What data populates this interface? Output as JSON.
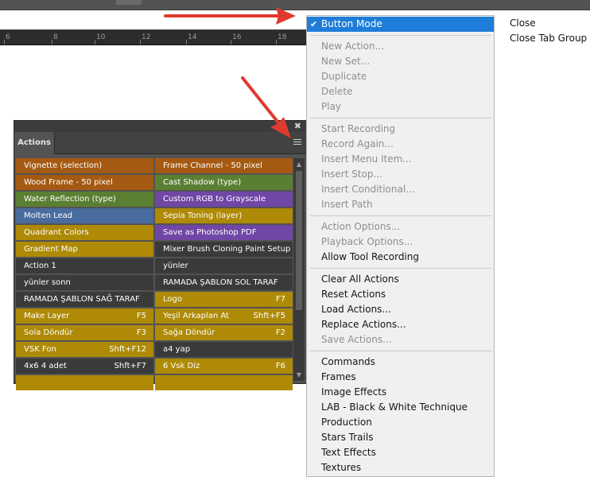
{
  "colors": {
    "orange": "#a45a12",
    "green": "#5a7f32",
    "purple": "#7046a6",
    "blue": "#4a6b9e",
    "yellow": "#ae8a06",
    "gray": "#3a3a3a",
    "menu_highlight": "#1e7dd8",
    "arrow_red": "#e03a2f"
  },
  "ruler": {
    "ticks": [
      "6",
      "8",
      "10",
      "12",
      "14",
      "16",
      "18"
    ]
  },
  "actions_panel": {
    "tab_label": "Actions",
    "close_glyph": "✖",
    "menu_icon": "hamburger-menu-icon",
    "rows": [
      [
        {
          "label": "Vignette (selection)",
          "key": "",
          "color": "orange"
        },
        {
          "label": "Frame Channel - 50 pixel",
          "key": "",
          "color": "orange"
        }
      ],
      [
        {
          "label": "Wood Frame - 50 pixel",
          "key": "",
          "color": "orange"
        },
        {
          "label": "Cast Shadow (type)",
          "key": "",
          "color": "green"
        }
      ],
      [
        {
          "label": "Water Reflection (type)",
          "key": "",
          "color": "green"
        },
        {
          "label": "Custom RGB to Grayscale",
          "key": "",
          "color": "purple"
        }
      ],
      [
        {
          "label": "Molten Lead",
          "key": "",
          "color": "blue"
        },
        {
          "label": "Sepia Toning (layer)",
          "key": "",
          "color": "yellow"
        }
      ],
      [
        {
          "label": "Quadrant Colors",
          "key": "",
          "color": "yellow"
        },
        {
          "label": "Save as Photoshop PDF",
          "key": "",
          "color": "purple"
        }
      ],
      [
        {
          "label": "Gradient Map",
          "key": "",
          "color": "yellow"
        },
        {
          "label": "Mixer Brush Cloning Paint Setup",
          "key": "",
          "color": "gray"
        }
      ],
      [
        {
          "label": "Action 1",
          "key": "",
          "color": "gray"
        },
        {
          "label": "yünler",
          "key": "",
          "color": "gray"
        }
      ],
      [
        {
          "label": "yünler sonn",
          "key": "",
          "color": "gray"
        },
        {
          "label": "RAMADA ŞABLON SOL TARAF",
          "key": "",
          "color": "gray"
        }
      ],
      [
        {
          "label": "RAMADA ŞABLON SAĞ TARAF",
          "key": "",
          "color": "gray"
        },
        {
          "label": "Logo",
          "key": "F7",
          "color": "yellow"
        }
      ],
      [
        {
          "label": "Make Layer",
          "key": "F5",
          "color": "yellow"
        },
        {
          "label": "Yeşil Arkaplan At",
          "key": "Shft+F5",
          "color": "yellow"
        }
      ],
      [
        {
          "label": "Sola Döndür",
          "key": "F3",
          "color": "yellow"
        },
        {
          "label": "Sağa Döndür",
          "key": "F2",
          "color": "yellow"
        }
      ],
      [
        {
          "label": "VSK Fon",
          "key": "Shft+F12",
          "color": "yellow"
        },
        {
          "label": "a4 yap",
          "key": "",
          "color": "gray"
        }
      ],
      [
        {
          "label": "4x6 4 adet",
          "key": "Shft+F7",
          "color": "gray"
        },
        {
          "label": "6 Vsk Diz",
          "key": "F6",
          "color": "yellow"
        }
      ],
      [
        {
          "label": "",
          "key": "",
          "color": "yellow"
        },
        {
          "label": "",
          "key": "",
          "color": "yellow"
        }
      ]
    ]
  },
  "panel_menu": {
    "check_glyph": "✔",
    "items": [
      {
        "label": "Button Mode",
        "state": "selected",
        "checked": true,
        "sep_after": false
      },
      {
        "label": "",
        "state": "sep"
      },
      {
        "label": "New Action...",
        "state": "disabled"
      },
      {
        "label": "New Set...",
        "state": "disabled"
      },
      {
        "label": "Duplicate",
        "state": "disabled"
      },
      {
        "label": "Delete",
        "state": "disabled"
      },
      {
        "label": "Play",
        "state": "disabled"
      },
      {
        "label": "",
        "state": "sep"
      },
      {
        "label": "Start Recording",
        "state": "disabled"
      },
      {
        "label": "Record Again...",
        "state": "disabled"
      },
      {
        "label": "Insert Menu Item...",
        "state": "disabled"
      },
      {
        "label": "Insert Stop...",
        "state": "disabled"
      },
      {
        "label": "Insert Conditional...",
        "state": "disabled"
      },
      {
        "label": "Insert Path",
        "state": "disabled"
      },
      {
        "label": "",
        "state": "sep"
      },
      {
        "label": "Action Options...",
        "state": "disabled"
      },
      {
        "label": "Playback Options...",
        "state": "disabled"
      },
      {
        "label": "Allow Tool Recording",
        "state": "enabled"
      },
      {
        "label": "",
        "state": "sep"
      },
      {
        "label": "Clear All Actions",
        "state": "enabled"
      },
      {
        "label": "Reset Actions",
        "state": "enabled"
      },
      {
        "label": "Load Actions...",
        "state": "enabled"
      },
      {
        "label": "Replace Actions...",
        "state": "enabled"
      },
      {
        "label": "Save Actions...",
        "state": "disabled"
      },
      {
        "label": "",
        "state": "sep"
      },
      {
        "label": "Commands",
        "state": "enabled"
      },
      {
        "label": "Frames",
        "state": "enabled"
      },
      {
        "label": "Image Effects",
        "state": "enabled"
      },
      {
        "label": "LAB - Black & White Technique",
        "state": "enabled"
      },
      {
        "label": "Production",
        "state": "enabled"
      },
      {
        "label": "Stars Trails",
        "state": "enabled"
      },
      {
        "label": "Text Effects",
        "state": "enabled"
      },
      {
        "label": "Textures",
        "state": "enabled"
      }
    ]
  },
  "context_menu": {
    "items": [
      "Close",
      "Close Tab Group"
    ]
  }
}
